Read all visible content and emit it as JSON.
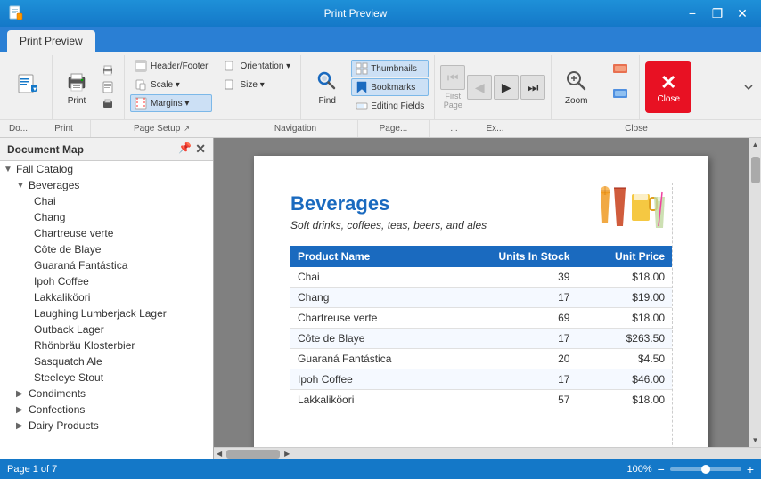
{
  "titlebar": {
    "title": "Print Preview",
    "app_icon": "📄",
    "minimize_label": "−",
    "restore_label": "❐",
    "close_label": "✕"
  },
  "tab": {
    "label": "Print Preview"
  },
  "ribbon": {
    "groups": [
      {
        "name": "do",
        "label": "Do...",
        "buttons": [
          {
            "id": "print-options",
            "icon": "📋",
            "label": ""
          }
        ]
      },
      {
        "name": "print",
        "label": "Print",
        "buttons": [
          {
            "id": "print",
            "icon": "🖨",
            "label": "Print"
          },
          {
            "id": "page-setup-cols",
            "label": ""
          }
        ]
      },
      {
        "name": "page-setup",
        "label": "Page Setup",
        "buttons": [
          {
            "id": "header-footer",
            "icon": "",
            "label": "Header/Footer"
          },
          {
            "id": "orientation",
            "icon": "",
            "label": "Orientation"
          },
          {
            "id": "scale",
            "icon": "",
            "label": "Scale"
          },
          {
            "id": "size",
            "icon": "",
            "label": "Size"
          },
          {
            "id": "margins",
            "icon": "",
            "label": "Margins"
          }
        ],
        "expand": true
      },
      {
        "name": "navigation",
        "label": "Navigation",
        "buttons": [
          {
            "id": "find",
            "icon": "🔍",
            "label": "Find"
          },
          {
            "id": "thumbnails",
            "label": "Thumbnails"
          },
          {
            "id": "bookmarks",
            "label": "Bookmarks"
          },
          {
            "id": "editing-fields",
            "label": "Editing Fields"
          }
        ]
      },
      {
        "name": "pages",
        "label": "Page...",
        "buttons": [
          {
            "id": "first-page",
            "label": "First\nPage"
          }
        ]
      },
      {
        "name": "zoom-group",
        "label": "Ex...",
        "buttons": [
          {
            "id": "zoom",
            "icon": "🔍",
            "label": "Zoom"
          }
        ]
      },
      {
        "name": "close-group",
        "label": "Close",
        "buttons": [
          {
            "id": "close",
            "icon": "✕",
            "label": "Close"
          }
        ]
      }
    ]
  },
  "docmap": {
    "title": "Document Map",
    "tree": {
      "root": {
        "label": "Fall Catalog",
        "children": [
          {
            "label": "Beverages",
            "expanded": true,
            "children": [
              {
                "label": "Chai"
              },
              {
                "label": "Chang"
              },
              {
                "label": "Chartreuse verte"
              },
              {
                "label": "Côte de Blaye"
              },
              {
                "label": "Guaraná Fantástica"
              },
              {
                "label": "Ipoh Coffee"
              },
              {
                "label": "Lakkaliköori"
              },
              {
                "label": "Laughing Lumberjack Lager"
              },
              {
                "label": "Outback Lager"
              },
              {
                "label": "Rhönbräu Klosterbier"
              },
              {
                "label": "Sasquatch Ale"
              },
              {
                "label": "Steeleye Stout"
              }
            ]
          },
          {
            "label": "Condiments",
            "expanded": false
          },
          {
            "label": "Confections",
            "expanded": false
          },
          {
            "label": "Dairy Products",
            "expanded": false
          }
        ]
      }
    }
  },
  "preview": {
    "section_title": "Beverages",
    "section_subtitle": "Soft drinks, coffees, teas, beers, and ales",
    "table": {
      "columns": [
        "Product Name",
        "Units In Stock",
        "Unit Price"
      ],
      "rows": [
        {
          "name": "Chai",
          "stock": "39",
          "price": "$18.00"
        },
        {
          "name": "Chang",
          "stock": "17",
          "price": "$19.00"
        },
        {
          "name": "Chartreuse verte",
          "stock": "69",
          "price": "$18.00"
        },
        {
          "name": "Côte de Blaye",
          "stock": "17",
          "price": "$263.50"
        },
        {
          "name": "Guaraná Fantástica",
          "stock": "20",
          "price": "$4.50"
        },
        {
          "name": "Ipoh Coffee",
          "stock": "17",
          "price": "$46.00"
        },
        {
          "name": "Lakkaliköori",
          "stock": "57",
          "price": "$18.00"
        }
      ]
    }
  },
  "statusbar": {
    "page_info": "Page 1 of 7",
    "zoom_level": "100%",
    "zoom_minus": "−",
    "zoom_plus": "+"
  }
}
